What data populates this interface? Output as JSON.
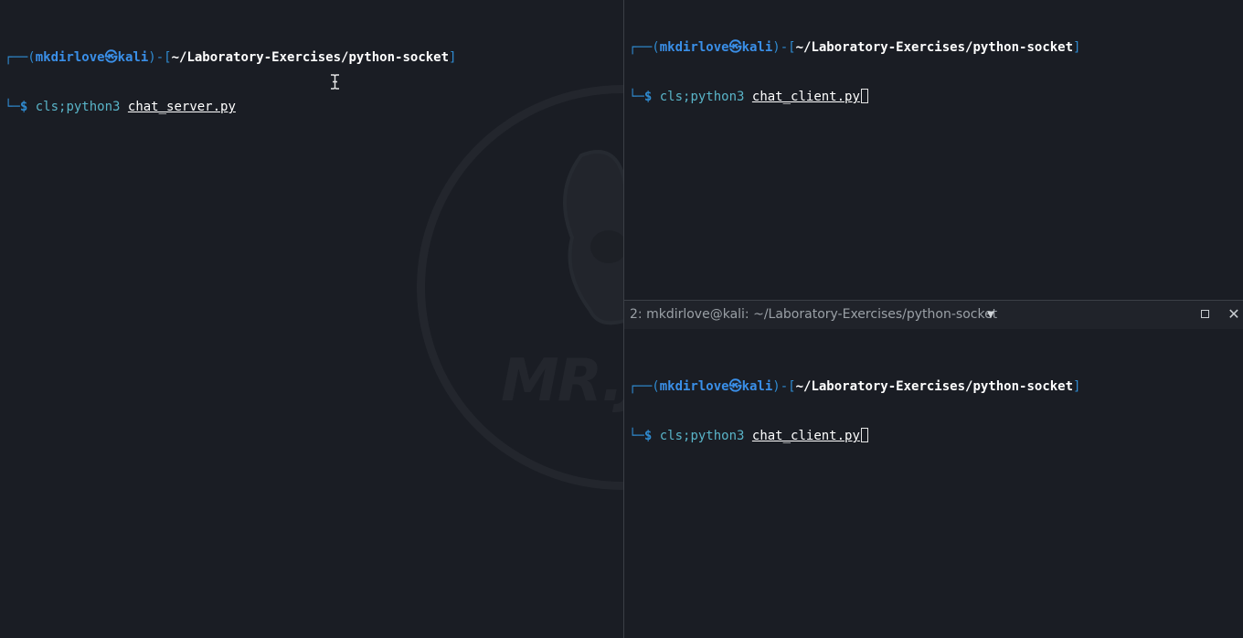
{
  "panes": {
    "left": {
      "user": "mkdirlove",
      "host": "kali",
      "path": "~/Laboratory-Exercises/python-socket",
      "command": "cls;python3",
      "argument": "chat_server.py",
      "logo_text": "MR.J"
    },
    "right_top": {
      "user": "mkdirlove",
      "host": "kali",
      "path": "~/Laboratory-Exercises/python-socket",
      "command": "cls;python3",
      "argument": "chat_client.py"
    },
    "right_bottom": {
      "tab_title": "2: mkdirlove@kali: ~/Laboratory-Exercises/python-socket",
      "user": "mkdirlove",
      "host": "kali",
      "path": "~/Laboratory-Exercises/python-socket",
      "command": "cls;python3",
      "argument": "chat_client.py"
    }
  },
  "prompt_glyphs": {
    "top_left": "┌──(",
    "host_sep": "㉿",
    "mid": ")-[",
    "end": "]",
    "bottom_left": "└─",
    "dollar": "$"
  },
  "icons": {
    "dropdown": "chevron-down-icon",
    "maximize": "maximize-icon",
    "close": "close-icon",
    "cursor": "text-cursor-icon"
  },
  "colors": {
    "background": "#1a1d24",
    "prompt_blue": "#3a8fe8",
    "command_cyan": "#59b4c8"
  }
}
